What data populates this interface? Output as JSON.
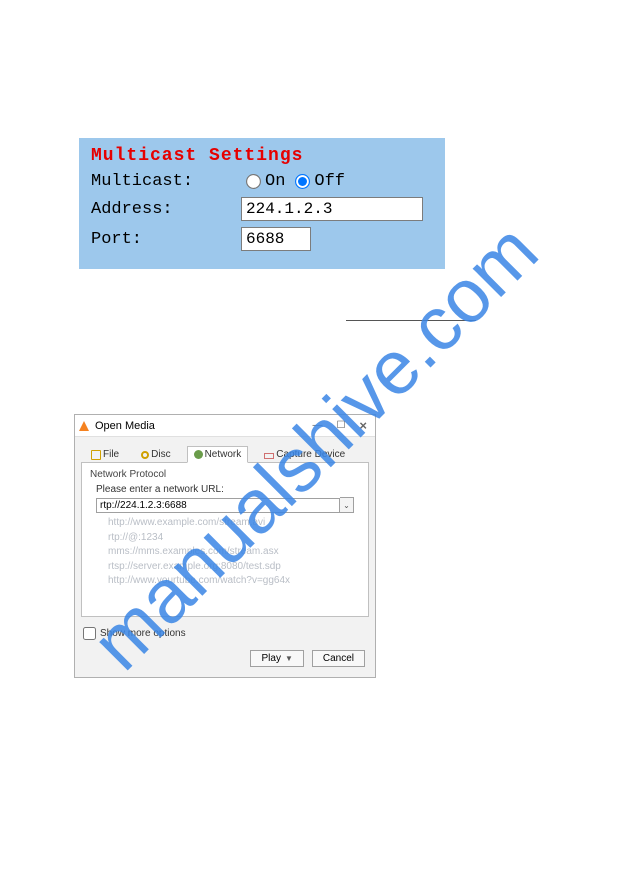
{
  "watermark": "manualshive.com",
  "multicast": {
    "title": "Multicast Settings",
    "row_multicast_label": "Multicast:",
    "on_label": "On",
    "off_label": "Off",
    "selected": "off",
    "row_address_label": "Address:",
    "address_value": "224.1.2.3",
    "row_port_label": "Port:",
    "port_value": "6688"
  },
  "vlc": {
    "window_title": "Open Media",
    "tabs": {
      "file": "File",
      "disc": "Disc",
      "network": "Network",
      "capture": "Capture Device"
    },
    "group_label": "Network Protocol",
    "prompt": "Please enter a network URL:",
    "url_value": "rtp://224.1.2.3:6688",
    "examples": [
      "http://www.example.com/stream.avi",
      "rtp://@:1234",
      "mms://mms.examples.com/stream.asx",
      "rtsp://server.example.org:8080/test.sdp",
      "http://www.yourtube.com/watch?v=gg64x"
    ],
    "show_more": "Show more options",
    "play": "Play",
    "cancel": "Cancel"
  }
}
